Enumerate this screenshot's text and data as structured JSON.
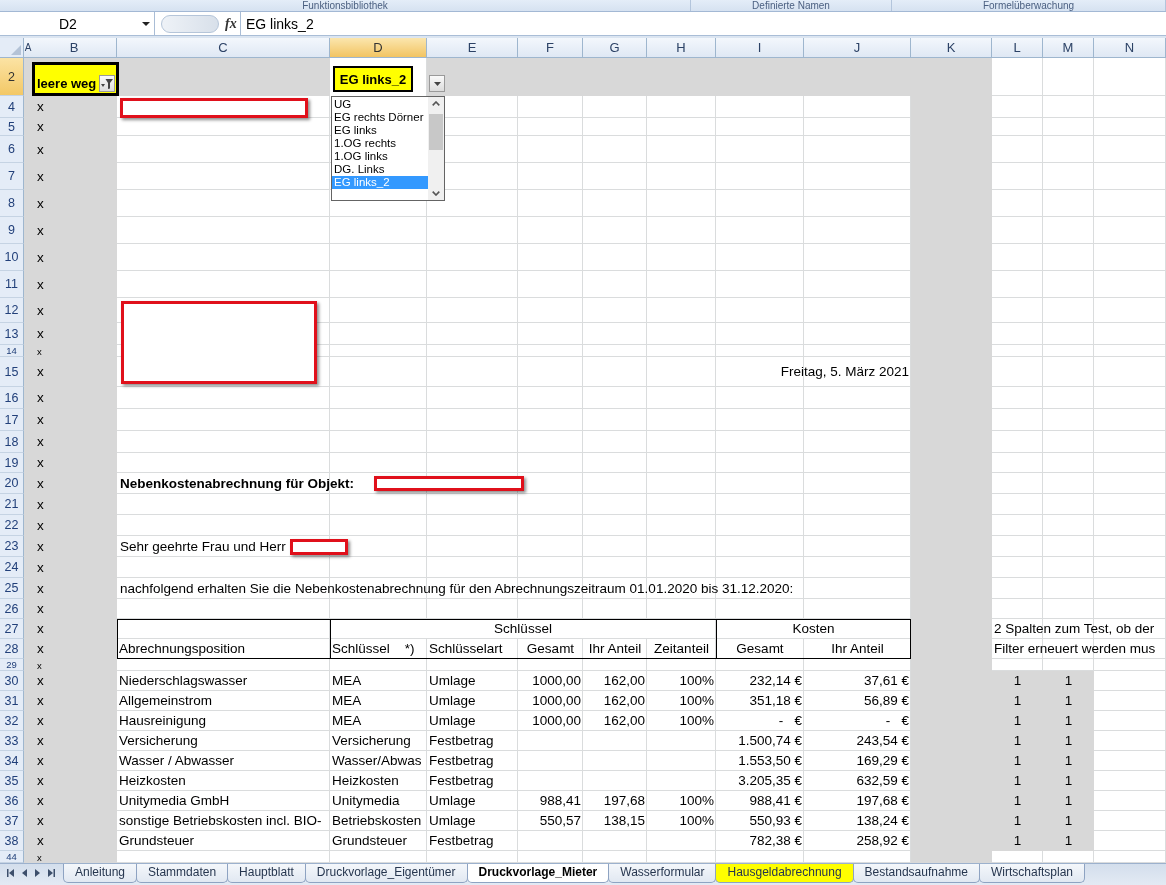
{
  "ribbon": {
    "groups": [
      "Funktionsbibliothek",
      "Definierte Namen",
      "Formelüberwachung"
    ]
  },
  "formula_bar": {
    "name_box": "D2",
    "function_label": "fx",
    "formula": "EG links_2"
  },
  "sheet": {
    "columns": [
      {
        "label": "A",
        "selected": false
      },
      {
        "label": "B",
        "selected": false
      },
      {
        "label": "C",
        "selected": false
      },
      {
        "label": "D",
        "selected": true
      },
      {
        "label": "E",
        "selected": false
      },
      {
        "label": "F",
        "selected": false
      },
      {
        "label": "G",
        "selected": false
      },
      {
        "label": "H",
        "selected": false
      },
      {
        "label": "I",
        "selected": false
      },
      {
        "label": "J",
        "selected": false
      },
      {
        "label": "K",
        "selected": false
      },
      {
        "label": "L",
        "selected": false
      },
      {
        "label": "M",
        "selected": false
      },
      {
        "label": "N",
        "selected": false
      }
    ],
    "rows": [
      {
        "number": "2",
        "selected": true,
        "kind": "filter",
        "filter_label": "leere weg",
        "value": "EG links_2",
        "dropdown": {
          "items": [
            {
              "label": "UG",
              "selected": false
            },
            {
              "label": "EG rechts Dörner",
              "selected": false
            },
            {
              "label": "EG links",
              "selected": false
            },
            {
              "label": "1.OG rechts",
              "selected": false
            },
            {
              "label": "1.OG links",
              "selected": false
            },
            {
              "label": "DG. Links",
              "selected": false
            },
            {
              "label": "EG links_2",
              "selected": true
            }
          ]
        }
      },
      {
        "number": "4",
        "selected": false,
        "kind": "blank",
        "mark": "x",
        "redaction": {
          "kind": "line"
        }
      },
      {
        "number": "5",
        "selected": false,
        "kind": "blank",
        "mark": "x"
      },
      {
        "number": "6",
        "selected": false,
        "kind": "blank",
        "mark": "x"
      },
      {
        "number": "7",
        "selected": false,
        "kind": "blank",
        "mark": "x"
      },
      {
        "number": "8",
        "selected": false,
        "kind": "blank",
        "mark": "x"
      },
      {
        "number": "9",
        "selected": false,
        "kind": "blank",
        "mark": "x"
      },
      {
        "number": "10",
        "selected": false,
        "kind": "blank",
        "mark": "x"
      },
      {
        "number": "11",
        "selected": false,
        "kind": "blank",
        "mark": "x"
      },
      {
        "number": "12",
        "selected": false,
        "kind": "blank",
        "mark": "x",
        "redaction": {
          "kind": "block"
        }
      },
      {
        "number": "13",
        "selected": false,
        "kind": "blank",
        "mark": "x"
      },
      {
        "number": "14",
        "selected": false,
        "kind": "blank",
        "mark": "x"
      },
      {
        "number": "15",
        "selected": false,
        "kind": "date",
        "mark": "x",
        "text": "Freitag, 5. März 2021"
      },
      {
        "number": "16",
        "selected": false,
        "kind": "blank",
        "mark": "x"
      },
      {
        "number": "17",
        "selected": false,
        "kind": "blank",
        "mark": "x"
      },
      {
        "number": "18",
        "selected": false,
        "kind": "blank",
        "mark": "x"
      },
      {
        "number": "19",
        "selected": false,
        "kind": "blank",
        "mark": "x"
      },
      {
        "number": "20",
        "selected": false,
        "kind": "heading",
        "mark": "x",
        "text": "Nebenkostenabrechnung für Objekt:",
        "redaction": {
          "kind": "line"
        }
      },
      {
        "number": "21",
        "selected": false,
        "kind": "blank",
        "mark": "x"
      },
      {
        "number": "22",
        "selected": false,
        "kind": "blank",
        "mark": "x"
      },
      {
        "number": "23",
        "selected": false,
        "kind": "text",
        "mark": "x",
        "text": "Sehr geehrte Frau und Herr",
        "redaction": {
          "kind": "line"
        }
      },
      {
        "number": "24",
        "selected": false,
        "kind": "blank",
        "mark": "x"
      },
      {
        "number": "25",
        "selected": false,
        "kind": "text",
        "mark": "x",
        "text": "nachfolgend erhalten Sie die Nebenkostenabrechnung für den Abrechnungszeitraum 01.01.2020 bis 31.12.2020:"
      },
      {
        "number": "26",
        "selected": false,
        "kind": "blank",
        "mark": "x"
      },
      {
        "number": "27",
        "selected": false,
        "kind": "group_header",
        "mark": "x",
        "groups": [
          "Schlüssel",
          "Kosten"
        ],
        "note": "2 Spalten zum Test, ob der"
      },
      {
        "number": "28",
        "selected": false,
        "kind": "column_header",
        "mark": "x",
        "headings": {
          "position": "Abrechnungsposition",
          "key": "Schlüssel    *)",
          "key_type": "Schlüsselart",
          "key_total": "Gesamt",
          "key_share": "Ihr Anteil",
          "time_share": "Zeitanteil",
          "cost_total": "Gesamt",
          "cost_share": "Ihr Anteil"
        },
        "note": "Filter erneuert werden mus"
      },
      {
        "number": "29",
        "selected": false,
        "kind": "blank",
        "mark": "x"
      },
      {
        "number": "30",
        "selected": false,
        "kind": "item",
        "mark": "x",
        "cells": {
          "position": "Niederschlagswasser",
          "key": "MEA",
          "key_type": "Umlage",
          "key_total": "1000,00",
          "key_share": "162,00",
          "time_share": "100%",
          "cost_total": "232,14 €",
          "cost_share": "37,61 €"
        },
        "test": [
          "1",
          "1"
        ]
      },
      {
        "number": "31",
        "selected": false,
        "kind": "item",
        "mark": "x",
        "cells": {
          "position": "Allgemeinstrom",
          "key": "MEA",
          "key_type": "Umlage",
          "key_total": "1000,00",
          "key_share": "162,00",
          "time_share": "100%",
          "cost_total": "351,18 €",
          "cost_share": "56,89 €"
        },
        "test": [
          "1",
          "1"
        ]
      },
      {
        "number": "32",
        "selected": false,
        "kind": "item",
        "mark": "x",
        "cells": {
          "position": "Hausreinigung",
          "key": "MEA",
          "key_type": "Umlage",
          "key_total": "1000,00",
          "key_share": "162,00",
          "time_share": "100%",
          "cost_total": "-   €",
          "cost_share": "-   €"
        },
        "test": [
          "1",
          "1"
        ]
      },
      {
        "number": "33",
        "selected": false,
        "kind": "item",
        "mark": "x",
        "cells": {
          "position": "Versicherung",
          "key": "Versicherung",
          "key_type": "Festbetrag",
          "cost_total": "1.500,74 €",
          "cost_share": "243,54 €"
        },
        "test": [
          "1",
          "1"
        ]
      },
      {
        "number": "34",
        "selected": false,
        "kind": "item",
        "mark": "x",
        "cells": {
          "position": "Wasser / Abwasser",
          "key": "Wasser/Abwas",
          "key_type": "Festbetrag",
          "cost_total": "1.553,50 €",
          "cost_share": "169,29 €"
        },
        "test": [
          "1",
          "1"
        ]
      },
      {
        "number": "35",
        "selected": false,
        "kind": "item",
        "mark": "x",
        "cells": {
          "position": "Heizkosten",
          "key": "Heizkosten",
          "key_type": "Festbetrag",
          "cost_total": "3.205,35 €",
          "cost_share": "632,59 €"
        },
        "test": [
          "1",
          "1"
        ]
      },
      {
        "number": "36",
        "selected": false,
        "kind": "item",
        "mark": "x",
        "cells": {
          "position": "Unitymedia GmbH",
          "key": "Unitymedia",
          "key_type": "Umlage",
          "key_total": "988,41",
          "key_share": "197,68",
          "time_share": "100%",
          "cost_total": "988,41 €",
          "cost_share": "197,68 €"
        },
        "test": [
          "1",
          "1"
        ]
      },
      {
        "number": "37",
        "selected": false,
        "kind": "item",
        "mark": "x",
        "cells": {
          "position": "sonstige Betriebskosten incl. BIO-",
          "key": "Betriebskosten",
          "key_type": "Umlage",
          "key_total": "550,57",
          "key_share": "138,15",
          "time_share": "100%",
          "cost_total": "550,93 €",
          "cost_share": "138,24 €"
        },
        "test": [
          "1",
          "1"
        ]
      },
      {
        "number": "38",
        "selected": false,
        "kind": "item",
        "mark": "x",
        "cells": {
          "position": "Grundsteuer",
          "key": "Grundsteuer",
          "key_type": "Festbetrag",
          "cost_total": "782,38 €",
          "cost_share": "258,92 €"
        },
        "test": [
          "1",
          "1"
        ]
      },
      {
        "number": "44",
        "selected": false,
        "kind": "blank",
        "mark": "x"
      }
    ]
  },
  "sheet_tabs": [
    {
      "label": "Anleitung",
      "selected": false
    },
    {
      "label": "Stammdaten",
      "selected": false
    },
    {
      "label": "Hauptblatt",
      "selected": false
    },
    {
      "label": "Druckvorlage_Eigentümer",
      "selected": false
    },
    {
      "label": "Druckvorlage_Mieter",
      "selected": true
    },
    {
      "label": "Wasserformular",
      "selected": false
    },
    {
      "label": "Hausgeldabrechnung",
      "selected": false,
      "color": "#ffff00"
    },
    {
      "label": "Bestandsaufnahme",
      "selected": false
    },
    {
      "label": "Wirtschaftsplan",
      "selected": false
    }
  ]
}
